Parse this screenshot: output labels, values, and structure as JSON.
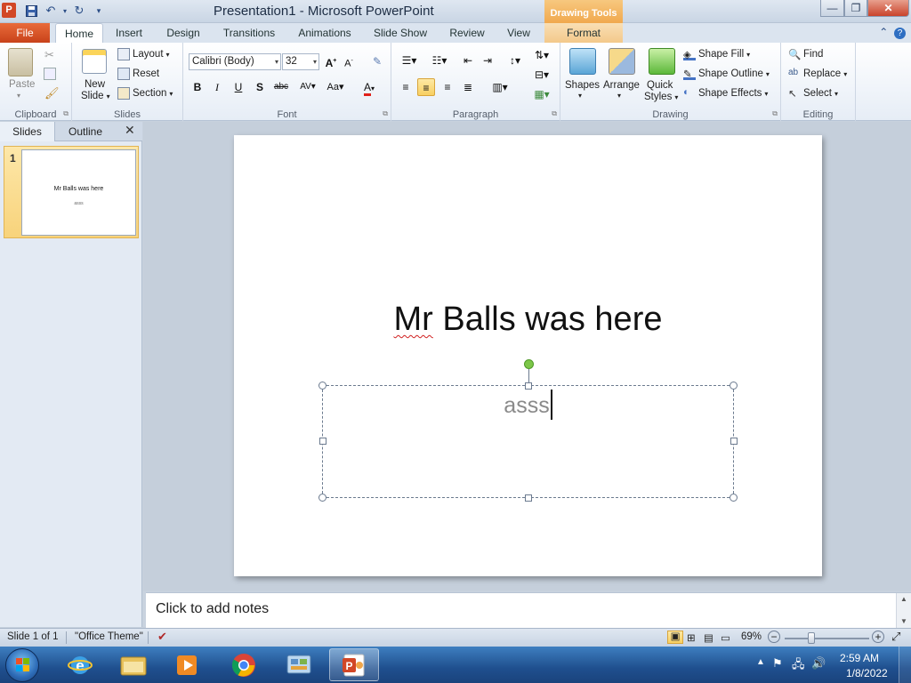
{
  "window": {
    "title": "Presentation1  -  Microsoft PowerPoint",
    "contextual_tab_group": "Drawing Tools"
  },
  "tabs": {
    "file": "File",
    "items": [
      "Home",
      "Insert",
      "Design",
      "Transitions",
      "Animations",
      "Slide Show",
      "Review",
      "View"
    ],
    "active": "Home",
    "contextual": "Format"
  },
  "ribbon": {
    "clipboard": {
      "label": "Clipboard",
      "paste": "Paste"
    },
    "slides": {
      "label": "Slides",
      "new_slide_1": "New",
      "new_slide_2": "Slide",
      "layout": "Layout",
      "reset": "Reset",
      "section": "Section"
    },
    "font": {
      "label": "Font",
      "font_name": "Calibri (Body)",
      "font_size": "32"
    },
    "paragraph": {
      "label": "Paragraph",
      "active_alignment": "center"
    },
    "drawing": {
      "label": "Drawing",
      "shapes": "Shapes",
      "arrange": "Arrange",
      "quick_styles_1": "Quick",
      "quick_styles_2": "Styles",
      "shape_fill": "Shape Fill",
      "shape_outline": "Shape Outline",
      "shape_effects": "Shape Effects"
    },
    "editing": {
      "label": "Editing",
      "find": "Find",
      "replace": "Replace",
      "select": "Select"
    }
  },
  "left_pane": {
    "tab_slides": "Slides",
    "tab_outline": "Outline",
    "slide_number": "1",
    "thumb_title": "Mr Balls was here",
    "thumb_subtitle": "asss"
  },
  "slide": {
    "title_word_1": "Mr",
    "title_rest": " Balls was here",
    "subtitle": "asss"
  },
  "notes": {
    "placeholder": "Click to add notes"
  },
  "status": {
    "slide_info": "Slide 1 of 1",
    "theme": "\"Office Theme\"",
    "zoom": "69%",
    "zoom_level": 0.69
  },
  "taskbar": {
    "time": "2:59 AM",
    "date": "1/8/2022",
    "apps": [
      "internet-explorer",
      "windows-explorer",
      "media-player",
      "chrome",
      "control-panel",
      "powerpoint"
    ]
  },
  "colors": {
    "file_tab": "#d24726",
    "drawing_tools": "#f0a64a",
    "taskbar": "#1f4f8e",
    "rotate_handle": "#7cc648"
  }
}
